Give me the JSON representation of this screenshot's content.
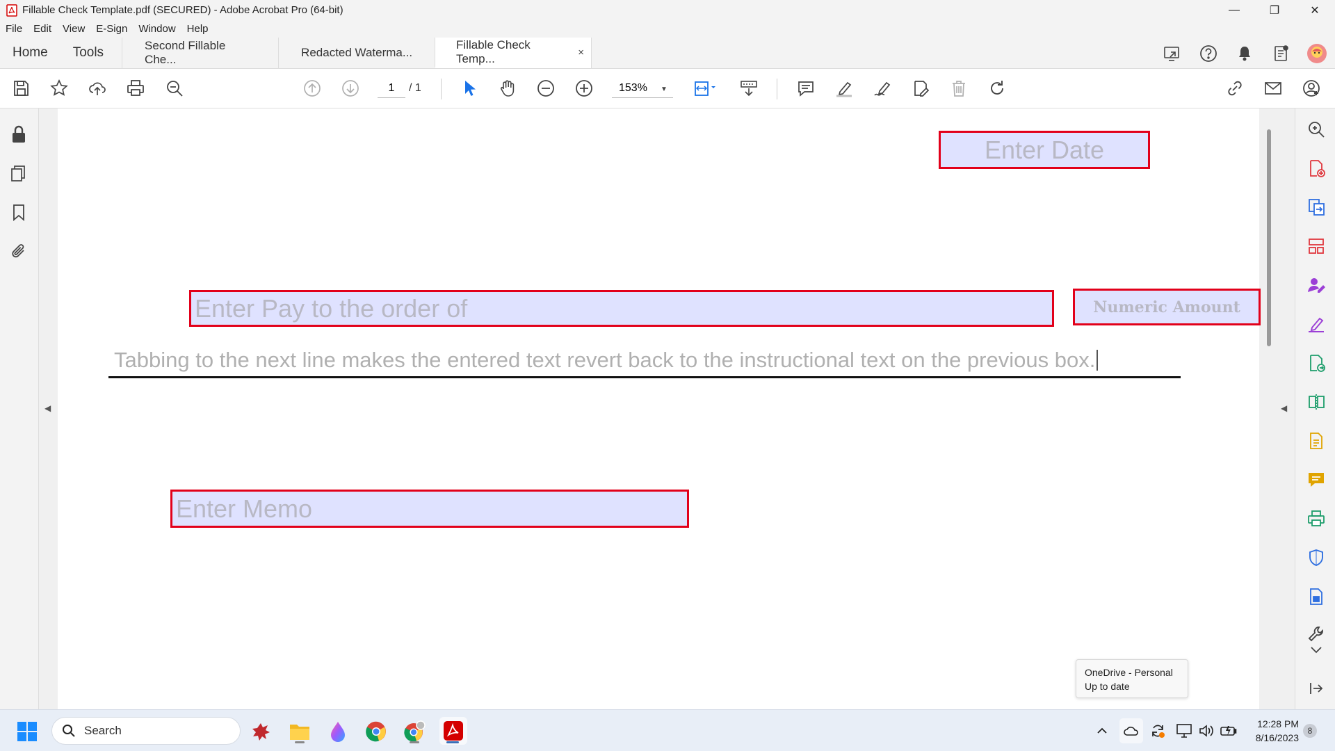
{
  "window": {
    "title": "Fillable Check Template.pdf (SECURED) - Adobe Acrobat Pro (64-bit)",
    "minimize": "—",
    "maximize": "❐",
    "close": "✕"
  },
  "menu": [
    "File",
    "Edit",
    "View",
    "E-Sign",
    "Window",
    "Help"
  ],
  "tabs": {
    "home": "Home",
    "tools": "Tools",
    "documents": [
      {
        "label": "Second Fillable Che..."
      },
      {
        "label": "Redacted Waterma..."
      },
      {
        "label": "Fillable Check Temp...",
        "active": true,
        "close": "×"
      }
    ]
  },
  "toolbar": {
    "page_current": "1",
    "page_total": "/ 1",
    "zoom": "153%"
  },
  "document": {
    "date_field": "Enter Date",
    "pay_to_field": "Enter Pay to the order of",
    "amount_field": "Numeric Amount",
    "amount_words_text": "Tabbing to the next line makes the entered text revert back to the instructional text on the previous box.",
    "memo_field": "Enter Memo"
  },
  "tooltip": {
    "line1": "OneDrive - Personal",
    "line2": "Up to date"
  },
  "taskbar": {
    "search_label": "Search",
    "time": "12:28 PM",
    "date": "8/16/2023",
    "notification_count": "8"
  },
  "colors": {
    "field_fill": "#dfe2ff",
    "field_border": "#e2001a",
    "accent": "#1a73e8",
    "acrobat_red": "#d40000"
  }
}
